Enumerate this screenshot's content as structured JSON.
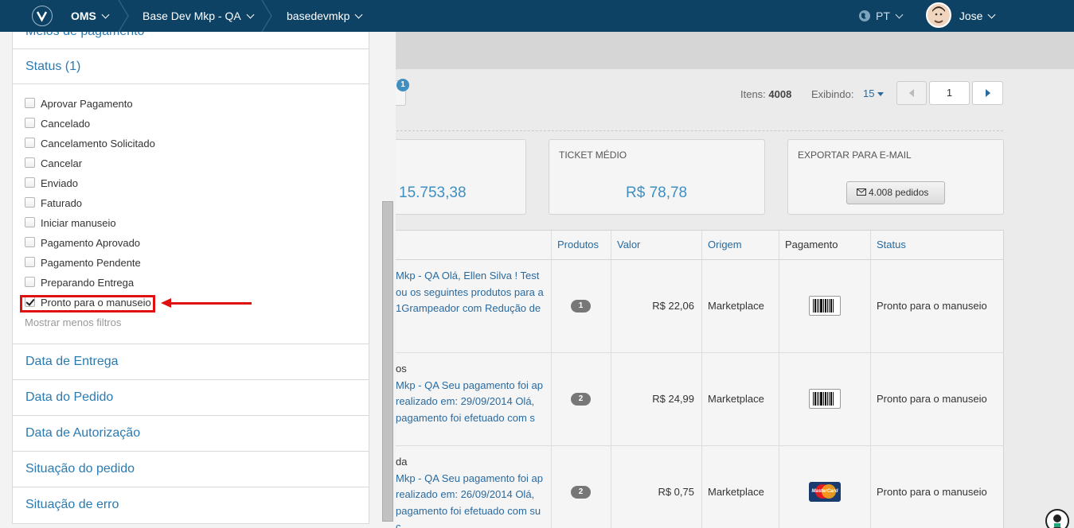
{
  "topbar": {
    "app": "OMS",
    "crumb1": "Base Dev Mkp - QA",
    "crumb2": "basedevmkp",
    "language": "PT",
    "user": "Jose"
  },
  "panel": {
    "sections_top": {
      "payment": "Meios de pagamento",
      "status": "Status (1)"
    },
    "status_options": [
      {
        "label": "Aprovar Pagamento",
        "checked": false
      },
      {
        "label": "Cancelado",
        "checked": false
      },
      {
        "label": "Cancelamento Solicitado",
        "checked": false
      },
      {
        "label": "Cancelar",
        "checked": false
      },
      {
        "label": "Enviado",
        "checked": false
      },
      {
        "label": "Faturado",
        "checked": false
      },
      {
        "label": "Iniciar manuseio",
        "checked": false
      },
      {
        "label": "Pagamento Aprovado",
        "checked": false
      },
      {
        "label": "Pagamento Pendente",
        "checked": false
      },
      {
        "label": "Preparando Entrega",
        "checked": false
      },
      {
        "label": "Pronto para o manuseio",
        "checked": true
      }
    ],
    "show_less": "Mostrar menos filtros",
    "sections_bottom": [
      "Data de Entrega",
      "Data do Pedido",
      "Data de Autorização",
      "Situação do pedido",
      "Situação de erro"
    ]
  },
  "toolbar": {
    "filter_badge": "1",
    "items_label": "Itens:",
    "items_count": "4008",
    "showing_label": "Exibindo:",
    "showing_value": "15",
    "page": "1"
  },
  "summary": {
    "total_value": "15.753,38",
    "ticket_label": "TICKET MÉDIO",
    "ticket_value": "R$ 78,78",
    "export_label": "EXPORTAR PARA E-MAIL",
    "export_button": "4.008 pedidos"
  },
  "table": {
    "headers": [
      "Produtos",
      "Valor",
      "Origem",
      "Pagamento",
      "Status"
    ],
    "rows": [
      {
        "cut": "",
        "lines": [
          "Mkp - QA Olá, Ellen Silva ! Test",
          "ou os seguintes produtos para a",
          "1Grampeador com Redução de"
        ],
        "products": "1",
        "value": "R$ 22,06",
        "origin": "Marketplace",
        "payment": "boleto",
        "status": "Pronto para o manuseio"
      },
      {
        "cut": "os",
        "lines": [
          "Mkp - QA Seu pagamento foi ap",
          "realizado em: 29/09/2014 Olá,",
          "pagamento foi efetuado com s"
        ],
        "products": "2",
        "value": "R$ 24,99",
        "origin": "Marketplace",
        "payment": "boleto",
        "status": "Pronto para o manuseio"
      },
      {
        "cut": "da",
        "lines": [
          "Mkp - QA Seu pagamento foi ap",
          "realizado em: 26/09/2014 Olá,",
          "pagamento foi efetuado com su",
          "c"
        ],
        "products": "2",
        "value": "R$ 0,75",
        "origin": "Marketplace",
        "payment": "mastercard",
        "status": "Pronto para o manuseio"
      }
    ],
    "mastercard_text": "MasterCard"
  },
  "colors": {
    "topbar": "#0d4265",
    "link": "#2a6a9e",
    "accent": "#3f8fc0",
    "highlight": "#e01010"
  }
}
